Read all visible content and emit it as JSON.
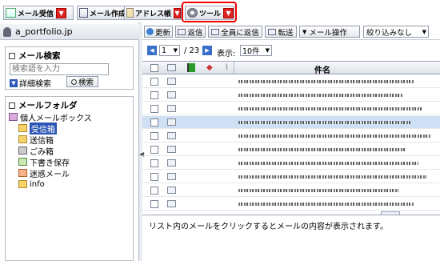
{
  "toolbar": {
    "tabs": [
      {
        "label": "メール受信",
        "icon": "mail-receive-icon"
      },
      {
        "label": "メール作成",
        "icon": "mail-compose-icon"
      },
      {
        "label": "アドレス帳",
        "icon": "address-book-icon"
      },
      {
        "label": "ツール",
        "icon": "gear-icon"
      }
    ],
    "dropdown_glyph": "▼"
  },
  "account": {
    "label": "a_portfolio.jp"
  },
  "search": {
    "title": "メール検索",
    "placeholder": "検索語を入力",
    "advanced_label": "詳細検索",
    "search_button": "検索"
  },
  "folders": {
    "title": "メールフォルダ",
    "root": "個人メールボックス",
    "items": [
      "受信箱",
      "送信箱",
      "ごみ箱",
      "下書き保存",
      "迷惑メール",
      "info"
    ]
  },
  "actions": {
    "refresh": "更新",
    "reply": "返信",
    "reply_all": "全員に返信",
    "forward": "転送",
    "mail_ops": "メール操作",
    "filter": "絞り込みなし"
  },
  "pager": {
    "page": "1",
    "total": "/ 23",
    "display_label": "表示:",
    "per_page": "10件"
  },
  "grid": {
    "column_subject": "件名"
  },
  "preview": {
    "message": "リスト内のメールをクリックするとメールの内容が表示されます。"
  },
  "colors": {
    "highlight": "#e00000",
    "dropdown": "#d22222",
    "selected_row": "#cfe0f4"
  }
}
